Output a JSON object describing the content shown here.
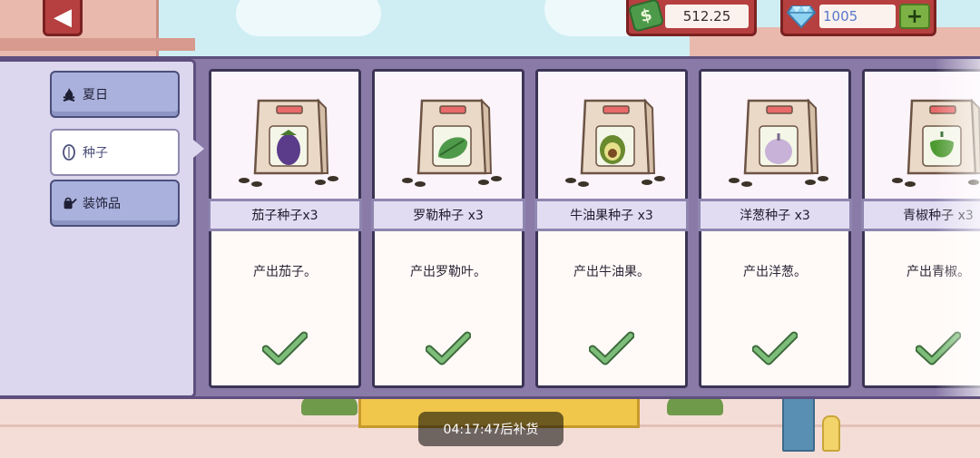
{
  "top_bar": {
    "back_icon": "back-arrow-icon",
    "money": {
      "icon": "money-icon",
      "value": "512.25"
    },
    "gems": {
      "icon": "gem-icon",
      "value": "1005",
      "add_label": "+"
    }
  },
  "categories": [
    {
      "label": "夏日",
      "icon": "campfire-icon",
      "active": false
    },
    {
      "label": "种子",
      "icon": "seed-icon",
      "active": true
    },
    {
      "label": "装饰品",
      "icon": "watering-can-icon",
      "active": false
    }
  ],
  "items": [
    {
      "name": "茄子种子x3",
      "desc": "产出茄子。",
      "icon": "eggplant-icon",
      "color": "#5a3c8a",
      "owned": true
    },
    {
      "name": "罗勒种子 x3",
      "desc": "产出罗勒叶。",
      "icon": "basil-icon",
      "color": "#4f9a4a",
      "owned": true
    },
    {
      "name": "牛油果种子 x3",
      "desc": "产出牛油果。",
      "icon": "avocado-icon",
      "color": "#6a8a2e",
      "owned": true
    },
    {
      "name": "洋葱种子 x3",
      "desc": "产出洋葱。",
      "icon": "onion-icon",
      "color": "#c8b2d8",
      "owned": true
    },
    {
      "name": "青椒种子 x3",
      "desc": "产出青椒。",
      "icon": "green-pepper-icon",
      "color": "#4e9a32",
      "owned": true
    }
  ],
  "restock": {
    "text": "04:17:47后补货"
  },
  "colors": {
    "panel": "#8a7aa8",
    "accent_red": "#b63f3f",
    "check_green": "#7dbd7a"
  }
}
